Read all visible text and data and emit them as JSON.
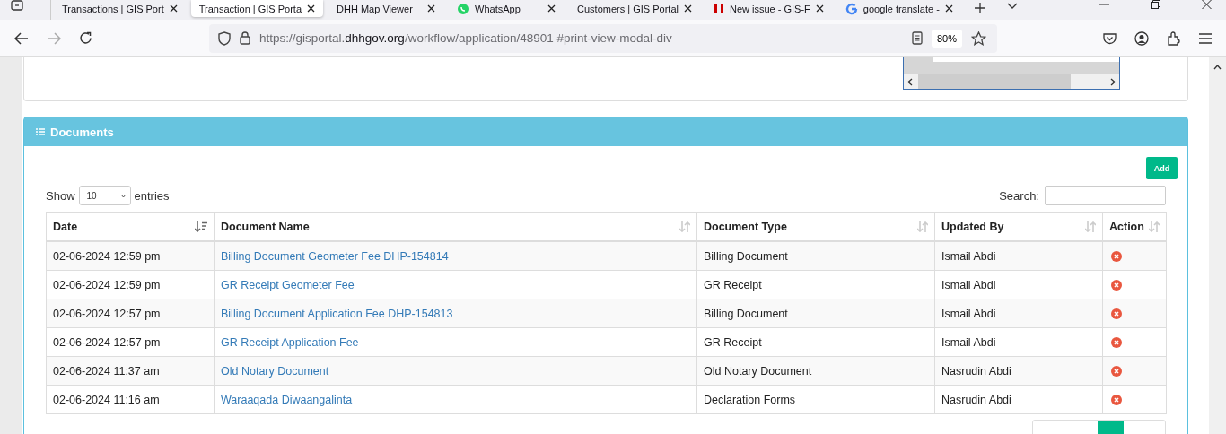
{
  "browser": {
    "tabs": [
      {
        "title": "Transactions | GIS Port",
        "selected": false,
        "kind": "plain"
      },
      {
        "title": "Transaction | GIS Porta",
        "selected": true,
        "kind": "plain"
      },
      {
        "title": "DHH Map Viewer",
        "selected": false,
        "kind": "plain"
      },
      {
        "title": "WhatsApp",
        "selected": false,
        "kind": "chat"
      },
      {
        "title": "Customers | GIS Portal",
        "selected": false,
        "kind": "plain"
      },
      {
        "title": "New issue - GIS-F",
        "selected": false,
        "kind": "issue"
      },
      {
        "title": "google translate -",
        "selected": false,
        "kind": "search"
      }
    ],
    "address": {
      "prefix": "https://gisportal.",
      "domain": "dhhgov.org",
      "rest": "/workflow/application/48901 #print-view-modal-div"
    },
    "zoom": "80%"
  },
  "documents": {
    "title": "Documents",
    "add_button": "Add",
    "show_label": "Show",
    "page_size": "10",
    "entries_label": "entries",
    "search_label": "Search:",
    "columns": [
      {
        "label": "Date",
        "sorted": true
      },
      {
        "label": "Document Name",
        "sorted": false
      },
      {
        "label": "Document Type",
        "sorted": false
      },
      {
        "label": "Updated By",
        "sorted": false
      },
      {
        "label": "Action",
        "sorted": false
      }
    ],
    "rows": [
      {
        "date": "02-06-2024 12:59 pm",
        "name": "Billing Document Geometer Fee DHP-154814",
        "type": "Billing Document",
        "updated_by": "Ismail Abdi"
      },
      {
        "date": "02-06-2024 12:59 pm",
        "name": "GR Receipt Geometer Fee",
        "type": "GR Receipt",
        "updated_by": "Ismail Abdi"
      },
      {
        "date": "02-06-2024 12:57 pm",
        "name": "Billing Document Application Fee DHP-154813",
        "type": "Billing Document",
        "updated_by": "Ismail Abdi"
      },
      {
        "date": "02-06-2024 12:57 pm",
        "name": "GR Receipt Application Fee",
        "type": "GR Receipt",
        "updated_by": "Ismail Abdi"
      },
      {
        "date": "02-06-2024 11:37 am",
        "name": "Old Notary Document",
        "type": "Old Notary Document",
        "updated_by": "Nasrudin Abdi"
      },
      {
        "date": "02-06-2024 11:16 am",
        "name": "Waraaqada Diwaangalinta",
        "type": "Declaration Forms",
        "updated_by": "Nasrudin Abdi"
      }
    ]
  }
}
